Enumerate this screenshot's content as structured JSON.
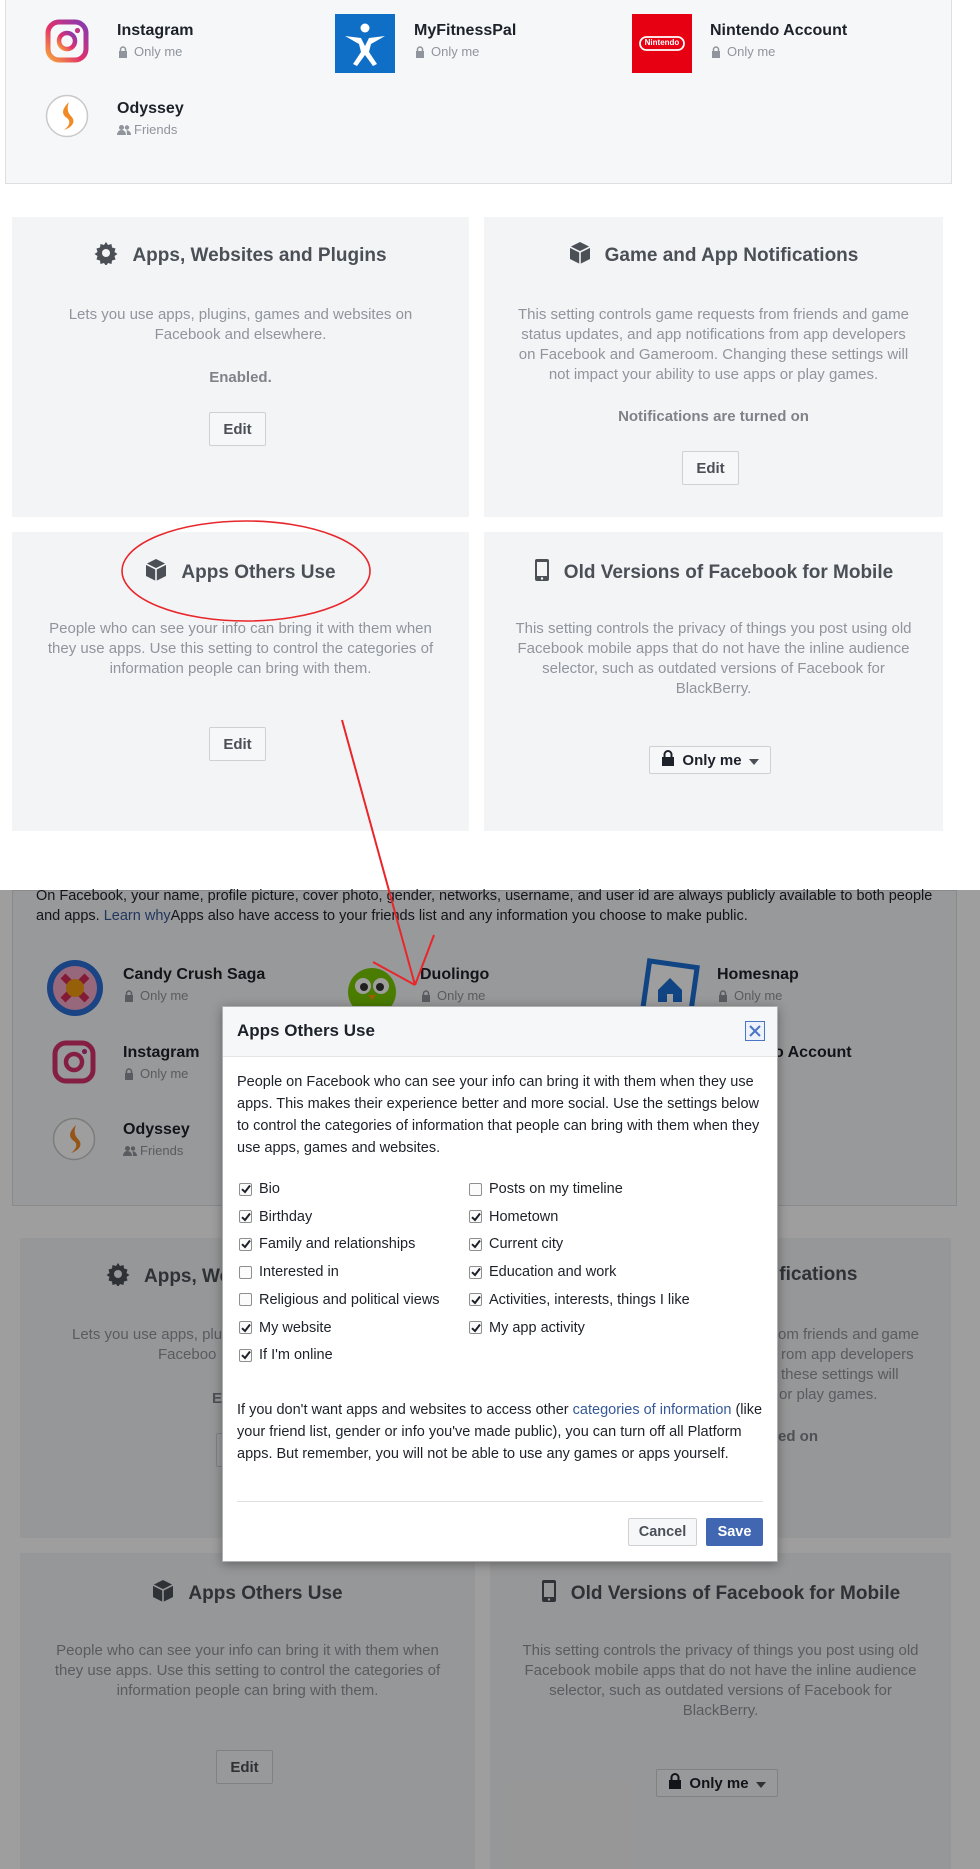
{
  "top_apps": [
    {
      "name": "Instagram",
      "privacy": "Only me",
      "icon": "instagram-icon"
    },
    {
      "name": "MyFitnessPal",
      "privacy": "Only me",
      "icon": "myfitnesspal-icon"
    },
    {
      "name": "Nintendo Account",
      "privacy": "Only me",
      "icon": "nintendo-icon"
    },
    {
      "name": "Odyssey",
      "privacy": "Friends",
      "icon": "odyssey-icon"
    }
  ],
  "nintendo_logo_text": "Nintendo",
  "cards": {
    "apps_websites": {
      "title": "Apps, Websites and Plugins",
      "desc": "Lets you use apps, plugins, games and websites on Facebook and elsewhere.",
      "status": "Enabled.",
      "button": "Edit"
    },
    "game_notifications": {
      "title": "Game and App Notifications",
      "desc": "This setting controls game requests from friends and game status updates, and app notifications from app developers on Facebook and Gameroom. Changing these settings will not impact your ability to use apps or play games.",
      "status": "Notifications are turned on",
      "button": "Edit"
    },
    "apps_others": {
      "title": "Apps Others Use",
      "desc": "People who can see your info can bring it with them when they use apps. Use this setting to control the categories of information people can bring with them.",
      "button": "Edit"
    },
    "old_versions": {
      "title": "Old Versions of Facebook for Mobile",
      "desc": "This setting controls the privacy of things you post using old Facebook mobile apps that do not have the inline audience selector, such as outdated versions of Facebook for BlackBerry.",
      "button": "Only me"
    }
  },
  "bg": {
    "info_text": "On Facebook, your name, profile picture, cover photo, gender, networks, username, and user id are always publicly available to both people and apps.",
    "learn_why": "Learn why",
    "info_text_2": "Apps also have access to your friends list and any information you choose to make public.",
    "apps": [
      {
        "name": "Candy Crush Saga",
        "privacy": "Only me"
      },
      {
        "name": "Duolingo",
        "privacy": "Only me"
      },
      {
        "name": "Homesnap",
        "privacy": "Only me"
      },
      {
        "name": "Instagram",
        "privacy": "Only me"
      },
      {
        "name": "Odyssey",
        "privacy": "Friends"
      }
    ],
    "nintendo_partial": "o Account",
    "apps_websites_partial": "Apps, We",
    "desc_left_partial_1": "Lets you use apps, plu",
    "desc_left_partial_2": "Faceboo",
    "status_left_partial": "E",
    "notif_title_partial": "ifications",
    "notif_desc_partial_1": "om friends and game",
    "notif_desc_partial_2": "rom app developers",
    "notif_desc_partial_3": "these settings will",
    "notif_desc_partial_4": "or play games.",
    "notif_status_partial": "ed on"
  },
  "dialog": {
    "title": "Apps Others Use",
    "intro": "People on Facebook who can see your info can bring it with them when they use apps. This makes their experience better and more social. Use the settings below to control the categories of information that people can bring with them when they use apps, games and websites.",
    "left_options": [
      {
        "label": "Bio",
        "checked": true
      },
      {
        "label": "Birthday",
        "checked": true
      },
      {
        "label": "Family and relationships",
        "checked": true
      },
      {
        "label": "Interested in",
        "checked": false
      },
      {
        "label": "Religious and political views",
        "checked": false
      },
      {
        "label": "My website",
        "checked": true
      },
      {
        "label": "If I'm online",
        "checked": true
      }
    ],
    "right_options": [
      {
        "label": "Posts on my timeline",
        "checked": false
      },
      {
        "label": "Hometown",
        "checked": true
      },
      {
        "label": "Current city",
        "checked": true
      },
      {
        "label": "Education and work",
        "checked": true
      },
      {
        "label": "Activities, interests, things I like",
        "checked": true
      },
      {
        "label": "My app activity",
        "checked": true
      }
    ],
    "note_before": "If you don't want apps and websites to access other ",
    "note_link": "categories of information",
    "note_after": " (like your friend list, gender or info you've made public), you can turn off all Platform apps. But remember, you will not be able to use any games or apps yourself.",
    "cancel": "Cancel",
    "save": "Save"
  },
  "colors": {
    "accent": "#4267b2",
    "link": "#365899",
    "annotation": "#e8262b"
  }
}
